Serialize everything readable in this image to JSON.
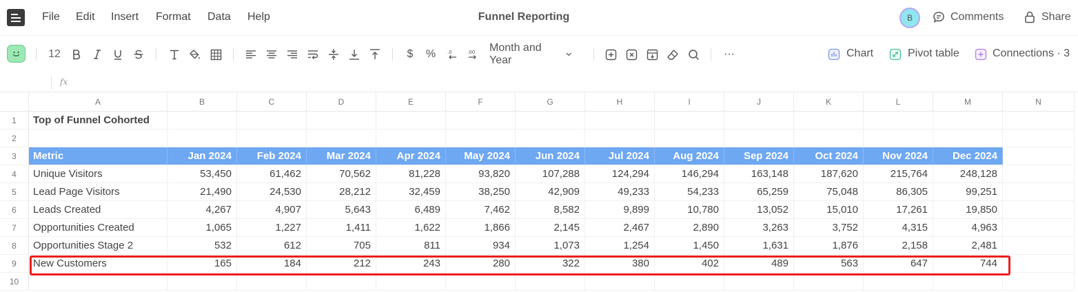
{
  "menu": {
    "items": [
      "File",
      "Edit",
      "Insert",
      "Format",
      "Data",
      "Help"
    ],
    "document_title": "Funnel Reporting",
    "avatar_initial": "B",
    "comments_label": "Comments",
    "share_label": "Share"
  },
  "toolbar": {
    "font_size": "12",
    "number_format": "Month and Year",
    "chart_label": "Chart",
    "pivot_label": "Pivot table",
    "connections_label": "Connections · 3",
    "more_label": "···",
    "currency_symbol": "$",
    "percent_symbol": "%"
  },
  "formula_bar": {
    "fx_label": "fx"
  },
  "grid": {
    "columns": [
      "A",
      "B",
      "C",
      "D",
      "E",
      "F",
      "G",
      "H",
      "I",
      "J",
      "K",
      "L",
      "M",
      "N"
    ],
    "row_numbers": [
      "1",
      "2",
      "3",
      "4",
      "5",
      "6",
      "7",
      "8",
      "9",
      "10"
    ],
    "title": "Top of Funnel Cohorted",
    "header": [
      "Metric",
      "Jan 2024",
      "Feb 2024",
      "Mar 2024",
      "Apr 2024",
      "May 2024",
      "Jun 2024",
      "Jul 2024",
      "Aug 2024",
      "Sep 2024",
      "Oct 2024",
      "Nov 2024",
      "Dec 2024"
    ],
    "rows": [
      [
        "Unique Visitors",
        "53,450",
        "61,462",
        "70,562",
        "81,228",
        "93,820",
        "107,288",
        "124,294",
        "146,294",
        "163,148",
        "187,620",
        "215,764",
        "248,128"
      ],
      [
        "Lead Page Visitors",
        "21,490",
        "24,530",
        "28,212",
        "32,459",
        "38,250",
        "42,909",
        "49,233",
        "54,233",
        "65,259",
        "75,048",
        "86,305",
        "99,251"
      ],
      [
        "Leads Created",
        "4,267",
        "4,907",
        "5,643",
        "6,489",
        "7,462",
        "8,582",
        "9,899",
        "10,780",
        "13,052",
        "15,010",
        "17,261",
        "19,850"
      ],
      [
        "Opportunities Created",
        "1,065",
        "1,227",
        "1,411",
        "1,622",
        "1,866",
        "2,145",
        "2,467",
        "2,890",
        "3,263",
        "3,752",
        "4,315",
        "4,963"
      ],
      [
        "Opportunities Stage 2",
        "532",
        "612",
        "705",
        "811",
        "934",
        "1,073",
        "1,254",
        "1,450",
        "1,631",
        "1,876",
        "2,158",
        "2,481"
      ],
      [
        "New Customers",
        "165",
        "184",
        "212",
        "243",
        "280",
        "322",
        "380",
        "402",
        "489",
        "563",
        "647",
        "744"
      ]
    ]
  },
  "colors": {
    "header_fill": "#6ea7f2",
    "highlight_border": "#ee1c1c",
    "avatar_fill": "#8fe6ef"
  }
}
